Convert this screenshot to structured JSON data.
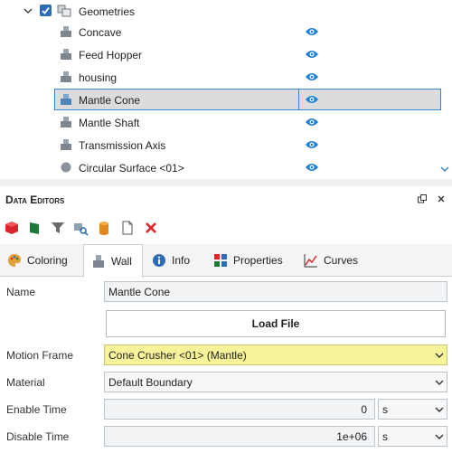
{
  "tree": {
    "root": {
      "label": "Geometries",
      "checked": true
    },
    "items": [
      {
        "label": "Concave",
        "icon": "geometry-icon",
        "selected": false
      },
      {
        "label": "Feed Hopper",
        "icon": "geometry-icon",
        "selected": false
      },
      {
        "label": "housing",
        "icon": "geometry-icon",
        "selected": false
      },
      {
        "label": "Mantle Cone",
        "icon": "geometry-icon",
        "selected": true
      },
      {
        "label": "Mantle Shaft",
        "icon": "geometry-icon",
        "selected": false
      },
      {
        "label": "Transmission Axis",
        "icon": "geometry-icon",
        "selected": false
      },
      {
        "label": "Circular Surface <01>",
        "icon": "circular-surface-icon",
        "selected": false
      }
    ]
  },
  "panel": {
    "title": "Data Editors",
    "toolbar": [
      "red-cube-icon",
      "green-flag-icon",
      "funnel-icon",
      "search-cube-icon",
      "cylinder-icon",
      "document-icon",
      "delete-x-icon"
    ]
  },
  "tabs": [
    {
      "label": "Coloring",
      "icon": "palette-icon",
      "active": false
    },
    {
      "label": "Wall",
      "icon": "wall-geometry-icon",
      "active": true
    },
    {
      "label": "Info",
      "icon": "info-icon",
      "active": false
    },
    {
      "label": "Properties",
      "icon": "properties-icon",
      "active": false
    },
    {
      "label": "Curves",
      "icon": "curves-icon",
      "active": false
    }
  ],
  "form": {
    "name_label": "Name",
    "name_value": "Mantle Cone",
    "load_file": "Load File",
    "motion_frame_label": "Motion Frame",
    "motion_frame_value": "Cone Crusher <01> (Mantle)",
    "material_label": "Material",
    "material_value": "Default Boundary",
    "enable_time_label": "Enable Time",
    "enable_time_value": "0",
    "enable_time_unit": "s",
    "disable_time_label": "Disable Time",
    "disable_time_value": "1e+06",
    "disable_time_unit": "s"
  },
  "colors": {
    "accent": "#3a86c8",
    "highlight": "#f7f39a",
    "eye": "#1f7fd1"
  }
}
